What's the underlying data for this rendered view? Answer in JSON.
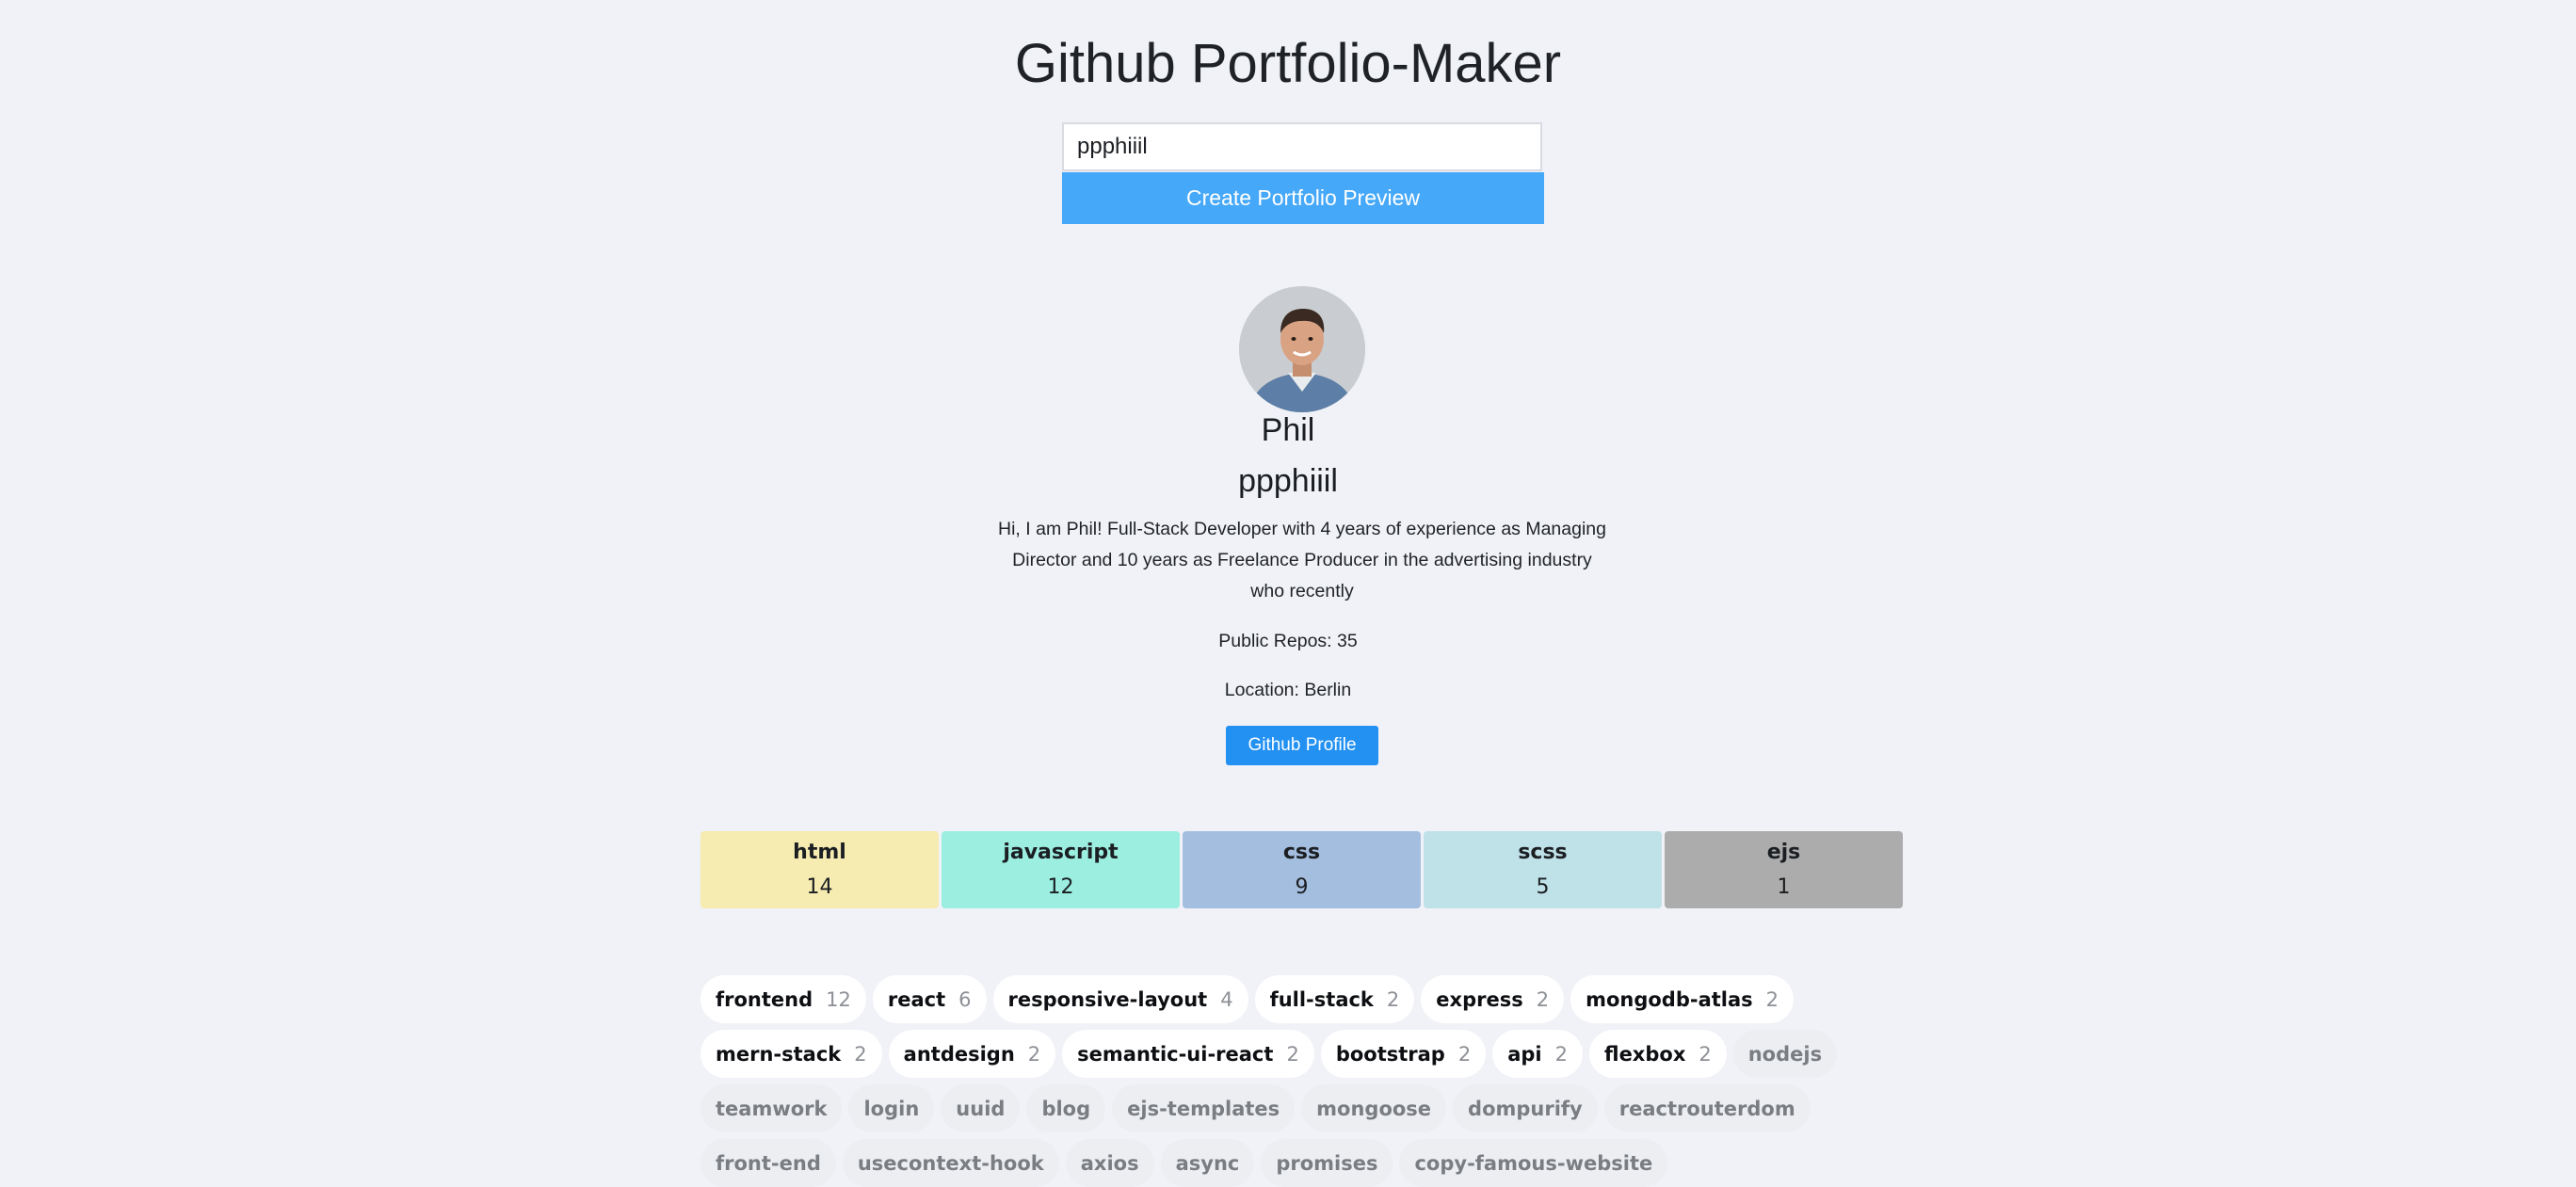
{
  "header": {
    "title": "Github Portfolio-Maker"
  },
  "search": {
    "value": "ppphiiil",
    "button_label": "Create Portfolio Preview"
  },
  "profile": {
    "name": "Phil",
    "username": "ppphiiil",
    "bio": "Hi, I am Phil! Full-Stack Developer with 4 years of experience as Managing Director and 10 years as Freelance Producer in the advertising industry who recently",
    "repos_text": "Public Repos: 35",
    "location_text": "Location: Berlin",
    "button_label": "Github Profile"
  },
  "languages": [
    {
      "name": "html",
      "count": "14",
      "color": "#f6ebb0"
    },
    {
      "name": "javascript",
      "count": "12",
      "color": "#9beee0"
    },
    {
      "name": "css",
      "count": "9",
      "color": "#a4bedf"
    },
    {
      "name": "scss",
      "count": "5",
      "color": "#bfe1e8"
    },
    {
      "name": "ejs",
      "count": "1",
      "color": "#acacac"
    }
  ],
  "topics": [
    {
      "label": "frontend",
      "count": "12",
      "active": true
    },
    {
      "label": "react",
      "count": "6",
      "active": true
    },
    {
      "label": "responsive-layout",
      "count": "4",
      "active": true
    },
    {
      "label": "full-stack",
      "count": "2",
      "active": true
    },
    {
      "label": "express",
      "count": "2",
      "active": true
    },
    {
      "label": "mongodb-atlas",
      "count": "2",
      "active": true
    },
    {
      "label": "mern-stack",
      "count": "2",
      "active": true
    },
    {
      "label": "antdesign",
      "count": "2",
      "active": true
    },
    {
      "label": "semantic-ui-react",
      "count": "2",
      "active": true
    },
    {
      "label": "bootstrap",
      "count": "2",
      "active": true
    },
    {
      "label": "api",
      "count": "2",
      "active": true
    },
    {
      "label": "flexbox",
      "count": "2",
      "active": true
    },
    {
      "label": "nodejs",
      "count": "",
      "active": false
    },
    {
      "label": "teamwork",
      "count": "",
      "active": false
    },
    {
      "label": "login",
      "count": "",
      "active": false
    },
    {
      "label": "uuid",
      "count": "",
      "active": false
    },
    {
      "label": "blog",
      "count": "",
      "active": false
    },
    {
      "label": "ejs-templates",
      "count": "",
      "active": false
    },
    {
      "label": "mongoose",
      "count": "",
      "active": false
    },
    {
      "label": "dompurify",
      "count": "",
      "active": false
    },
    {
      "label": "reactrouterdom",
      "count": "",
      "active": false
    },
    {
      "label": "front-end",
      "count": "",
      "active": false
    },
    {
      "label": "usecontext-hook",
      "count": "",
      "active": false
    },
    {
      "label": "axios",
      "count": "",
      "active": false
    },
    {
      "label": "async",
      "count": "",
      "active": false
    },
    {
      "label": "promises",
      "count": "",
      "active": false
    },
    {
      "label": "copy-famous-website",
      "count": "",
      "active": false
    }
  ],
  "colors": {
    "background": "#f0f2f7",
    "primary_button": "#46a8f8",
    "profile_button": "#2291f2"
  }
}
